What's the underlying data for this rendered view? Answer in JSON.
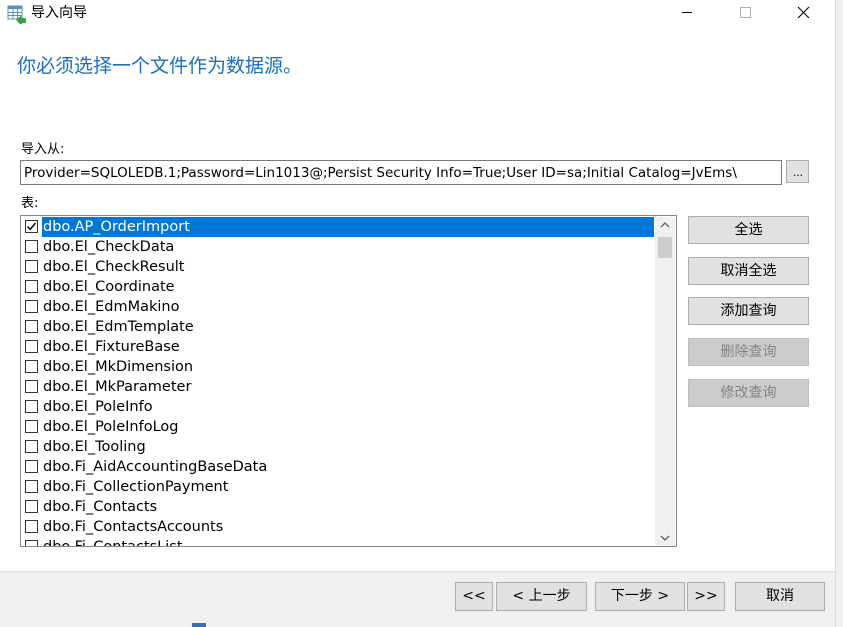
{
  "window": {
    "title": "导入向导"
  },
  "heading": "你必须选择一个文件作为数据源。",
  "import_from": {
    "label": "导入从:",
    "value": "Provider=SQLOLEDB.1;Password=Lin1013@;Persist Security Info=True;User ID=sa;Initial Catalog=JvEms\\",
    "browse_label": "..."
  },
  "tables": {
    "label": "表:",
    "items": [
      {
        "name": "dbo.AP_OrderImport",
        "checked": true,
        "selected": true
      },
      {
        "name": "dbo.El_CheckData",
        "checked": false,
        "selected": false
      },
      {
        "name": "dbo.El_CheckResult",
        "checked": false,
        "selected": false
      },
      {
        "name": "dbo.El_Coordinate",
        "checked": false,
        "selected": false
      },
      {
        "name": "dbo.El_EdmMakino",
        "checked": false,
        "selected": false
      },
      {
        "name": "dbo.El_EdmTemplate",
        "checked": false,
        "selected": false
      },
      {
        "name": "dbo.El_FixtureBase",
        "checked": false,
        "selected": false
      },
      {
        "name": "dbo.El_MkDimension",
        "checked": false,
        "selected": false
      },
      {
        "name": "dbo.El_MkParameter",
        "checked": false,
        "selected": false
      },
      {
        "name": "dbo.El_PoleInfo",
        "checked": false,
        "selected": false
      },
      {
        "name": "dbo.El_PoleInfoLog",
        "checked": false,
        "selected": false
      },
      {
        "name": "dbo.El_Tooling",
        "checked": false,
        "selected": false
      },
      {
        "name": "dbo.Fi_AidAccountingBaseData",
        "checked": false,
        "selected": false
      },
      {
        "name": "dbo.Fi_CollectionPayment",
        "checked": false,
        "selected": false
      },
      {
        "name": "dbo.Fi_Contacts",
        "checked": false,
        "selected": false
      },
      {
        "name": "dbo.Fi_ContactsAccounts",
        "checked": false,
        "selected": false
      },
      {
        "name": "dbo.Fi_ContactsList",
        "checked": false,
        "selected": false
      }
    ]
  },
  "side_buttons": {
    "select_all": "全选",
    "deselect_all": "取消全选",
    "add_query": "添加查询",
    "delete_query": "删除查询",
    "modify_query": "修改查询"
  },
  "nav": {
    "first": "<<",
    "prev": "< 上一步",
    "next": "下一步 >",
    "last": ">>",
    "cancel": "取消"
  },
  "icons": {
    "app": "table-import-icon",
    "minimize": "minimize-icon",
    "maximize": "maximize-icon",
    "close": "close-icon",
    "checkbox_check": "check-icon",
    "scroll_up": "chevron-up-icon",
    "scroll_down": "chevron-down-icon"
  },
  "colors": {
    "heading": "#1a6fc8",
    "selection": "#0078d7",
    "button_face": "#e1e1e1",
    "button_disabled": "#cccccc",
    "footer": "#f0f0f0"
  }
}
